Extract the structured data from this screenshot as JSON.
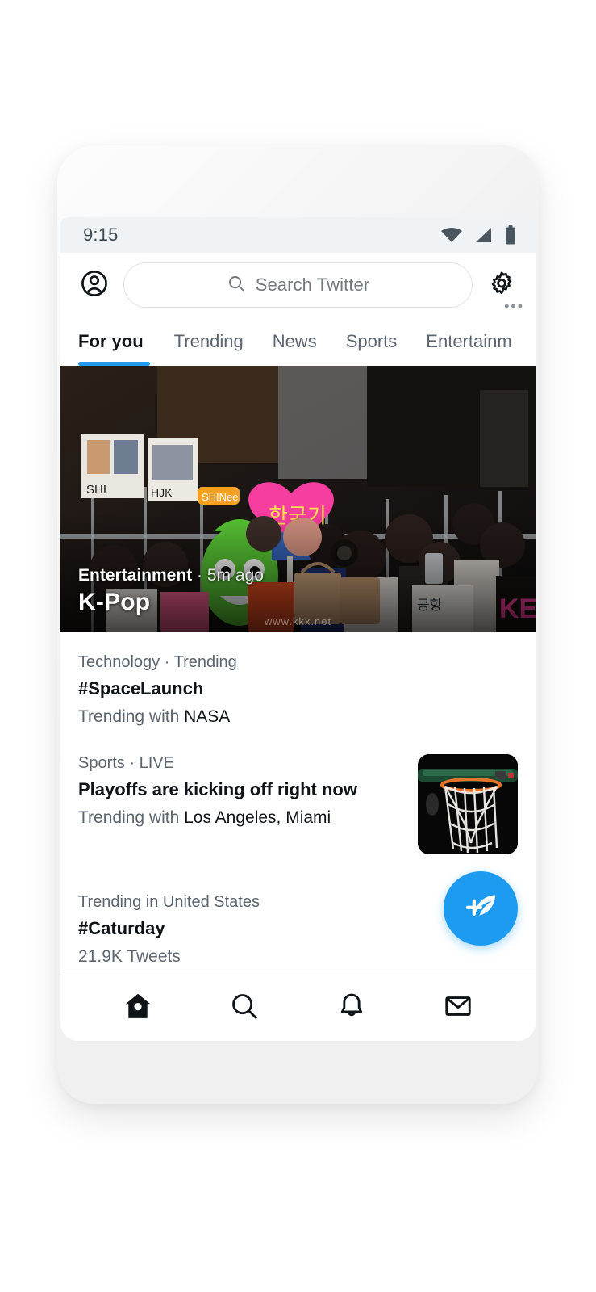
{
  "statusbar": {
    "time": "9:15",
    "icons": [
      "wifi-icon",
      "cellular-icon",
      "battery-icon"
    ]
  },
  "header": {
    "avatar_icon": "profile-circle-icon",
    "search_placeholder": "Search Twitter",
    "search_icon": "search-icon",
    "settings_icon": "gear-icon"
  },
  "tabs": [
    {
      "label": "For you",
      "active": true
    },
    {
      "label": "Trending",
      "active": false
    },
    {
      "label": "News",
      "active": false
    },
    {
      "label": "Sports",
      "active": false
    },
    {
      "label": "Entertainm",
      "active": false
    }
  ],
  "hero": {
    "category": "Entertainment",
    "separator": " · ",
    "time": "5m ago",
    "title": "K-Pop",
    "watermark": "www.kkx.net"
  },
  "trends": [
    {
      "kicker": "Technology · Trending",
      "title": "#SpaceLaunch",
      "meta_prefix": "Trending with ",
      "meta_strong": "NASA",
      "thumb": null
    },
    {
      "kicker": "Sports · LIVE",
      "title": "Playoffs are kicking off right now",
      "meta_prefix": "Trending with ",
      "meta_strong": "Los Angeles, Miami",
      "thumb": "basketball-hoop-thumbnail"
    },
    {
      "kicker": "Trending in United States",
      "title": "#Caturday",
      "meta_prefix": "21.9K Tweets",
      "meta_strong": "",
      "thumb": null
    }
  ],
  "fab": {
    "icon": "compose-tweet-icon",
    "overflow": "•••"
  },
  "bottomnav": [
    {
      "icon": "home-icon",
      "active": true
    },
    {
      "icon": "search-icon",
      "active": false
    },
    {
      "icon": "bell-icon",
      "active": false
    },
    {
      "icon": "mail-icon",
      "active": false
    }
  ],
  "colors": {
    "accent": "#1d9bf0",
    "text_primary": "#0f1419",
    "text_secondary": "#5b6570",
    "screen_bg": "#ffffff",
    "statusbar_bg": "#eff3f6",
    "phone_body": "#f0f0f0"
  }
}
